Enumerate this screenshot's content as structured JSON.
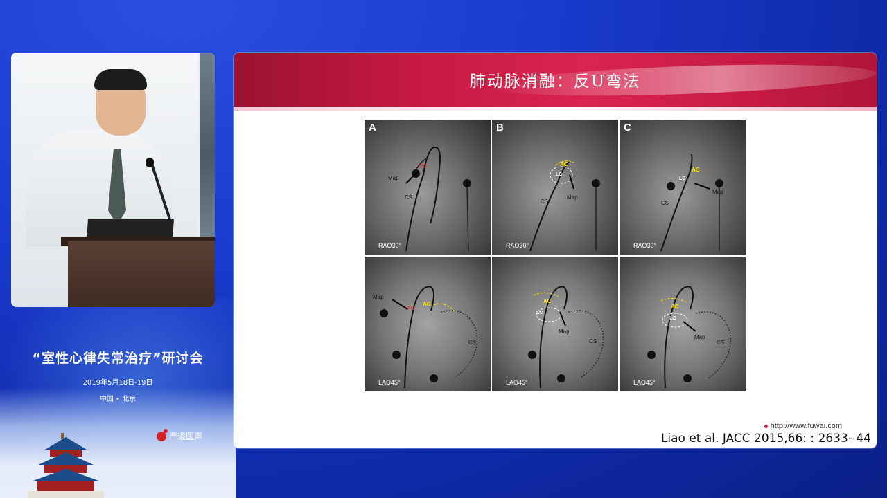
{
  "event": {
    "title": "“室性心律失常治疗”研讨会",
    "date": "2019年5月18日-19日",
    "location": "中国 • 北京",
    "sponsor_logo_text": "严道医声"
  },
  "slide": {
    "title": "肺动脉消融：反U弯法",
    "source_url": "http://www.fuwai.com",
    "citation": "Liao et al. JACC 2015,66: : 2633- 44",
    "panels": [
      {
        "letter": "A",
        "view": "RAO30°",
        "labels": {
          "map": "Map",
          "cs": "CS",
          "pc": "PC"
        }
      },
      {
        "letter": "B",
        "view": "RAO30°",
        "labels": {
          "ac": "AC",
          "lc": "LC",
          "map": "Map",
          "cs": "CS"
        }
      },
      {
        "letter": "C",
        "view": "RAO30°",
        "labels": {
          "ac": "AC",
          "lc": "LC",
          "map": "Map",
          "cs": "CS"
        }
      },
      {
        "letter": "",
        "view": "LAO45°",
        "labels": {
          "map": "Map",
          "ac": "AC",
          "cs": "CS",
          "pc": "PC"
        }
      },
      {
        "letter": "",
        "view": "LAO45°",
        "labels": {
          "ac": "AC",
          "lc": "LC",
          "map": "Map",
          "cs": "CS"
        }
      },
      {
        "letter": "",
        "view": "LAO45°",
        "labels": {
          "ac": "AC",
          "lc": "LC",
          "map": "Map",
          "cs": "CS"
        }
      }
    ]
  },
  "colors": {
    "background": "#1a3bd0",
    "slide_header": "#c2183f",
    "annotation_yellow": "#ffe600",
    "annotation_red": "#e33"
  }
}
